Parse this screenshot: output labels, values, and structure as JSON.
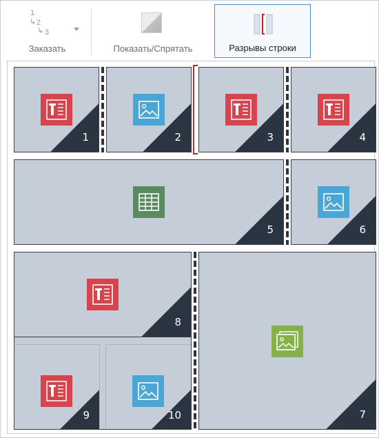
{
  "toolbar": {
    "order": {
      "label": "Заказать",
      "icon": "order-steps-icon",
      "digits": [
        "1",
        "2",
        "3"
      ]
    },
    "show_hide": {
      "label": "Показать/Спрятать",
      "icon": "show-hide-icon"
    },
    "line_breaks": {
      "label": "Разрывы строки",
      "icon": "line-breaks-icon",
      "selected": true
    }
  },
  "tiles": [
    {
      "number": "1",
      "content": "text",
      "icon": "text-icon"
    },
    {
      "number": "2",
      "content": "image",
      "icon": "image-icon"
    },
    {
      "number": "3",
      "content": "text",
      "icon": "text-icon"
    },
    {
      "number": "4",
      "content": "text",
      "icon": "text-icon"
    },
    {
      "number": "5",
      "content": "table",
      "icon": "table-icon"
    },
    {
      "number": "6",
      "content": "image",
      "icon": "image-icon"
    },
    {
      "number": "7",
      "content": "image-gallery",
      "icon": "image-gallery-icon"
    },
    {
      "number": "8",
      "content": "text",
      "icon": "text-icon"
    },
    {
      "number": "9",
      "content": "text",
      "icon": "text-icon"
    },
    {
      "number": "10",
      "content": "image",
      "icon": "image-icon"
    }
  ],
  "colors": {
    "text_icon": "#d9434b",
    "image_icon": "#4aa6d5",
    "table_icon": "#5a8a5e",
    "gallery_icon": "#86b04a",
    "tile_bg": "#c5ced8",
    "corner": "#2b3542",
    "break_marker": "#c0272d",
    "selected_border": "#4a90cc"
  }
}
